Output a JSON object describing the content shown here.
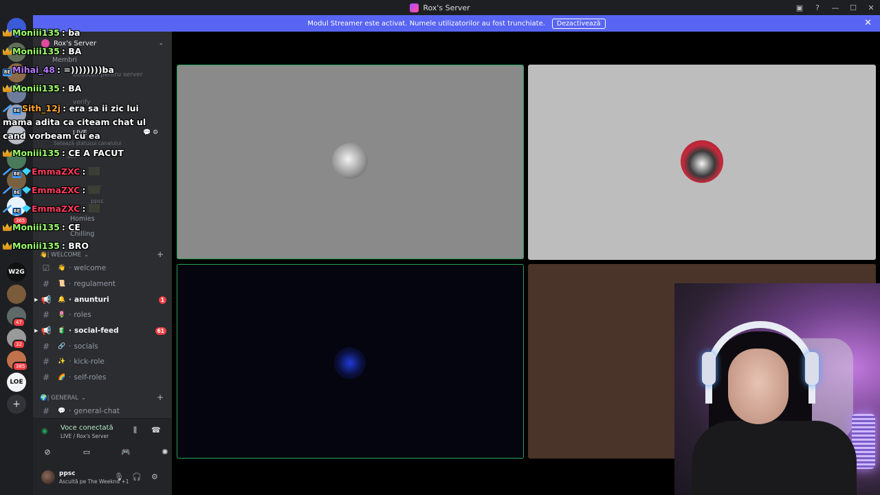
{
  "window": {
    "title": "Rox's Server"
  },
  "banner": {
    "text": "Modul Streamer este activat. Numele utilizatorilor au fost trunchiate.",
    "button": "Dezactivează"
  },
  "sidebar": {
    "server_name": "Rox's Server",
    "members_label": "Membri",
    "boosts_label": "Boosturi pentru server",
    "verify_label": "verify",
    "live_channel": "LIVE",
    "live_status_hint": "Setează statusul canalului",
    "voice_users": [
      "atti",
      "ppsc",
      "ppsc"
    ],
    "homies_label": "Homies",
    "chilling_label": "Chilling",
    "categories": {
      "welcome": "| WELCOME",
      "general": "| GENERAL"
    },
    "channels": [
      {
        "emoji": "👋",
        "name": "welcome",
        "badge": ""
      },
      {
        "emoji": "📜",
        "name": "regulament",
        "badge": ""
      },
      {
        "emoji": "🔔",
        "name": "anunturi",
        "badge": "1"
      },
      {
        "emoji": "🌷",
        "name": "roles",
        "badge": ""
      },
      {
        "emoji": "🧃",
        "name": "social-feed",
        "badge": "61"
      },
      {
        "emoji": "🔗",
        "name": "socials",
        "badge": ""
      },
      {
        "emoji": "✨",
        "name": "kick-role",
        "badge": ""
      },
      {
        "emoji": "🌈",
        "name": "self-roles",
        "badge": ""
      },
      {
        "emoji": "💬",
        "name": "general-chat",
        "badge": ""
      }
    ]
  },
  "guild_badges": [
    "365",
    "47",
    "32",
    "385"
  ],
  "guild_labels": {
    "w2g": "W2G",
    "loe": "LOE"
  },
  "voice_panel": {
    "title": "Voce conectată",
    "subtitle": "LIVE / Rox's Server"
  },
  "user_panel": {
    "name": "ppsc",
    "status": "Ascultă pe The Weeknd +1"
  },
  "chat": [
    {
      "user": "Moniii135",
      "text": "ba",
      "color": "#9dff6b"
    },
    {
      "user": "Moniii135",
      "text": "BA",
      "color": "#9dff6b"
    },
    {
      "user": "Mihai_48",
      "text": "=))))))))ba",
      "color": "#b67bff"
    },
    {
      "user": "Moniii135",
      "text": "BA",
      "color": "#9dff6b"
    },
    {
      "user": "Sith_12j",
      "text": "era sa ii zic lui mama adita ca citeam chat ul cand vorbeam cu ea",
      "color": "#ffa62b"
    },
    {
      "user": "Moniii135",
      "text": "CE A FACUT",
      "color": "#9dff6b"
    },
    {
      "user": "EmmaZXC",
      "text": "",
      "color": "#ff3b5c"
    },
    {
      "user": "EmmaZXC",
      "text": "",
      "color": "#ff3b5c"
    },
    {
      "user": "EmmaZXC",
      "text": "",
      "color": "#ff3b5c"
    },
    {
      "user": "Moniii135",
      "text": "CE",
      "color": "#9dff6b"
    },
    {
      "user": "Moniii135",
      "text": "BRO",
      "color": "#9dff6b"
    }
  ],
  "colors": {
    "accent": "#5865f2",
    "speaking": "#23a55a",
    "mention": "#f23f43"
  }
}
